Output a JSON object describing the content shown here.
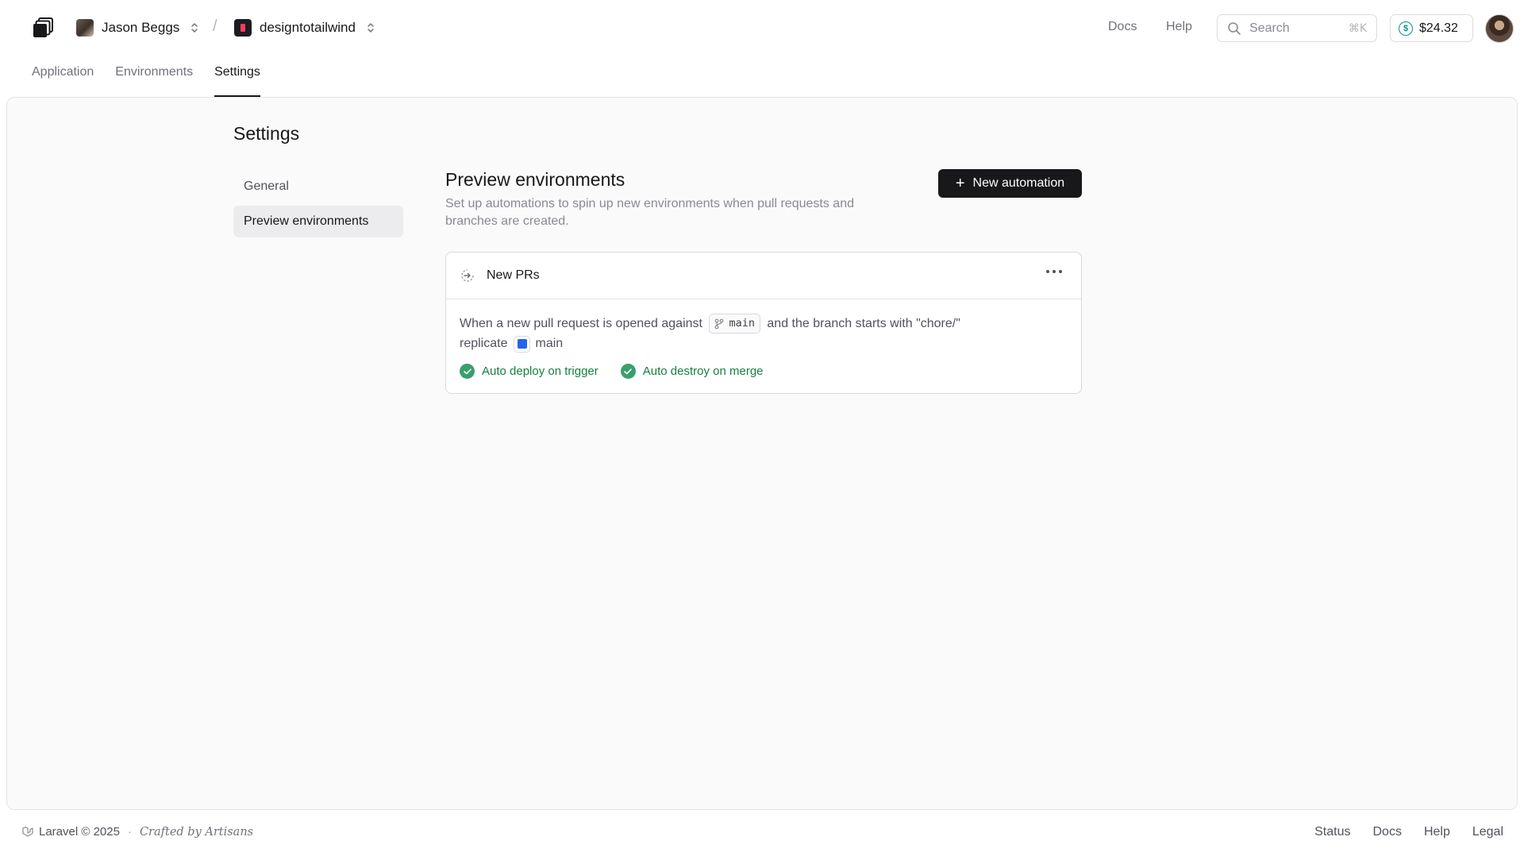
{
  "header": {
    "account": {
      "name": "Jason Beggs"
    },
    "project": {
      "name": "designtotailwind"
    },
    "separator": "/",
    "links": {
      "docs": "Docs",
      "help": "Help"
    },
    "search": {
      "placeholder": "Search",
      "shortcut": "⌘K"
    },
    "credit": {
      "amount": "$24.32"
    }
  },
  "tabs": [
    {
      "label": "Application",
      "active": false
    },
    {
      "label": "Environments",
      "active": false
    },
    {
      "label": "Settings",
      "active": true
    }
  ],
  "page": {
    "title": "Settings"
  },
  "sidenav": [
    {
      "label": "General",
      "active": false
    },
    {
      "label": "Preview environments",
      "active": true
    }
  ],
  "section": {
    "title": "Preview environments",
    "description": "Set up automations to spin up new environments when pull requests and branches are created.",
    "new_button": "New automation"
  },
  "automation": {
    "name": "New PRs",
    "text_1": "When a new pull request is opened against",
    "branch": "main",
    "text_2": "and the branch starts with \"chore/\"",
    "text_3": "replicate",
    "environment": "main",
    "environment_color": "#2563eb",
    "badges": [
      "Auto deploy on trigger",
      "Auto destroy on merge"
    ]
  },
  "footer": {
    "copyright": "Laravel © 2025",
    "dot": "·",
    "crafted": "Crafted by Artisans",
    "links": [
      "Status",
      "Docs",
      "Help",
      "Legal"
    ]
  }
}
